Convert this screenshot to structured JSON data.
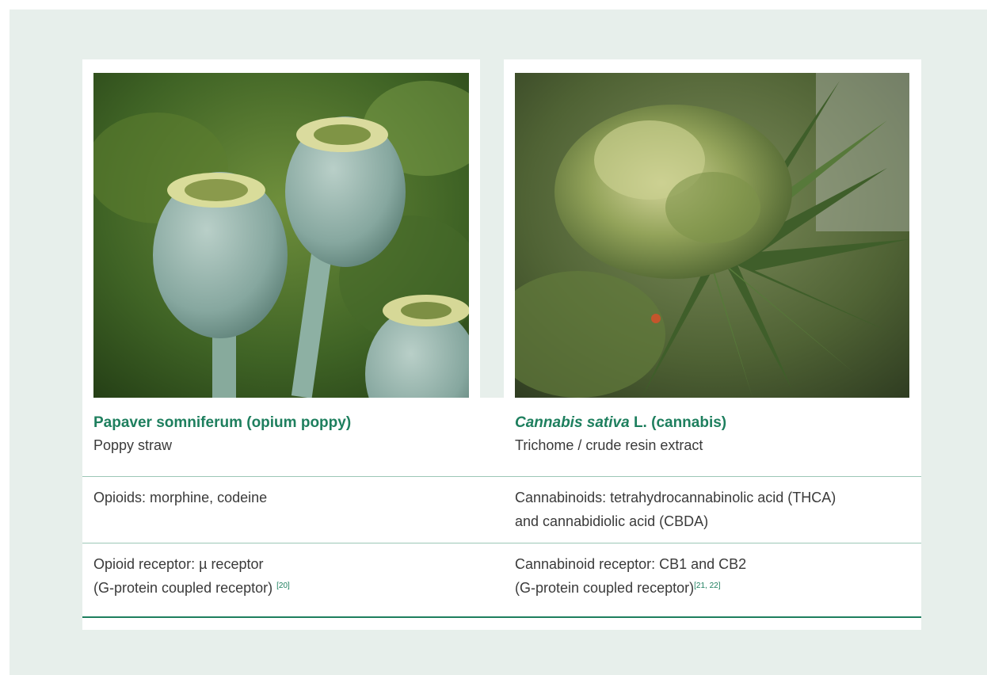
{
  "left": {
    "title": "Papaver somniferum (opium poppy)",
    "subtitle": "Poppy straw",
    "compounds": "Opioids: morphine, codeine",
    "receptor_line1": "Opioid receptor: µ receptor",
    "receptor_line2": "(G-protein coupled receptor) ",
    "receptor_ref": "[20]",
    "image_icon": "opium-poppy-photo"
  },
  "right": {
    "title_italic": "Cannabis sativa",
    "title_rest": " L. (cannabis)",
    "subtitle": "Trichome / crude resin extract",
    "compounds_line1": "Cannabinoids: tetrahydrocannabinolic acid (THCA)",
    "compounds_line2": "and cannabidiolic acid (CBDA)",
    "receptor_line1": "Cannabinoid receptor: CB1 and CB2",
    "receptor_line2": "(G-protein coupled receptor)",
    "receptor_ref": "[21, 22]",
    "image_icon": "cannabis-plant-photo"
  },
  "colors": {
    "background_panel": "#e7efeb",
    "title_green": "#1e7f5e",
    "body_text": "#3a3a3a",
    "rule": "#9cc7b6"
  }
}
